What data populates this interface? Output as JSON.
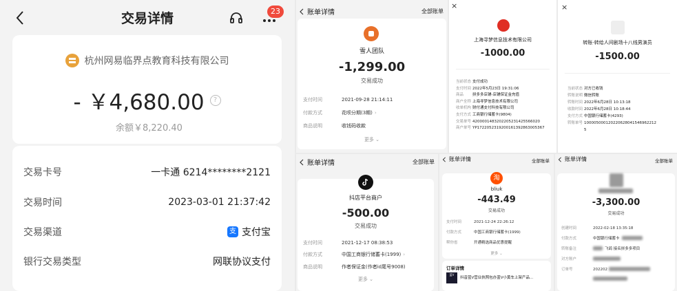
{
  "main": {
    "back_icon": "chevron-left-icon",
    "title": "交易详情",
    "support_icon": "headset-icon",
    "more_icon": "ellipsis-icon",
    "badge": "23",
    "merchant": "杭州网易临界点教育科技有限公司",
    "amount": "- ￥4,680.00",
    "balance": "余额￥8,220.40",
    "rows": [
      {
        "label": "交易卡号",
        "value": "一卡通 6214********2121"
      },
      {
        "label": "交易时间",
        "value": "2023-03-01 21:37:42"
      },
      {
        "label": "交易渠道",
        "value": "支付宝"
      },
      {
        "label": "银行交易类型",
        "value": "网联协议支付"
      }
    ]
  },
  "s1": {
    "header_title": "账单详情",
    "header_right": "全部账单",
    "name": "雪人团队",
    "amount": "-1,299.00",
    "status": "交易成功",
    "rows": [
      {
        "label": "支付时间",
        "value": "2021-09-28 21:14:11"
      },
      {
        "label": "付款方式",
        "value": "花呗分期(3期)"
      },
      {
        "label": "商品说明",
        "value": "收钱码收款"
      }
    ],
    "more": "更多"
  },
  "s2": {
    "close": "×",
    "name": "上海寻梦信息技术有限公司",
    "amount": "-1000.00",
    "rows": [
      {
        "label": "当前状态",
        "value": "支付成功"
      },
      {
        "label": "支付时间",
        "value": "2022年5月23日 19:31:06"
      },
      {
        "label": "商品",
        "value": "拼多多店铺-店铺保证金充值"
      },
      {
        "label": "商户全称",
        "value": "上海寻梦信息技术有限公司"
      },
      {
        "label": "收单机构",
        "value": "财付通支付科技有限公司"
      },
      {
        "label": "支付方式",
        "value": "工商银行储蓄卡(9804)"
      },
      {
        "label": "交易单号",
        "value": "4200001483202205231425566020"
      },
      {
        "label": "商户单号",
        "value": "YP17220523192001613928630053​67"
      }
    ]
  },
  "s3": {
    "close": "×",
    "name": "转账-转给人间剧场十八线男演员",
    "amount": "-1500.00",
    "rows": [
      {
        "label": "当前状态",
        "value": "对方已收钱"
      },
      {
        "label": "转账说明",
        "value": "微信转账"
      },
      {
        "label": "转账时间",
        "value": "2022年6月28日 10:13:18"
      },
      {
        "label": "收款时间",
        "value": "2022年6月28日 10:18:44"
      },
      {
        "label": "支付方式",
        "value": "中国银行储蓄卡(4293)"
      },
      {
        "label": "转账单号",
        "value": "1000050001202206280415469622125"
      }
    ]
  },
  "s4": {
    "header_title": "账单详情",
    "header_right": "全部账单",
    "name": "抖店平台商户",
    "amount": "-500.00",
    "status": "交易成功",
    "rows": [
      {
        "label": "支付时间",
        "value": "2021-12-17 08:38:53"
      },
      {
        "label": "付款方式",
        "value": "中国工商银行储蓄卡(1999)"
      },
      {
        "label": "商品说明",
        "value": "作者保证金(作者id尾号9008)"
      }
    ],
    "more": "更多"
  },
  "s5": {
    "header_title": "账单详情",
    "header_right": "全部账单",
    "name": "bliuk",
    "amount": "-443.49",
    "status": "交易成功",
    "rows": [
      {
        "label": "支付时间",
        "value": "2021-12-24 22:26:12"
      },
      {
        "label": "付款方式",
        "value": "中国工商银行储蓄卡(1999)"
      },
      {
        "label": "帮你省",
        "value": "开通精选商品优惠提醒"
      }
    ],
    "more": "更多",
    "order_title": "订单详情",
    "order_text": "抖音蓝V营业执照包办蓝V小黄车上架产品..."
  },
  "s6": {
    "header_title": "账单详情",
    "header_right": "全部账单",
    "amount": "-3,300.00",
    "status": "交易成功",
    "rows": [
      {
        "label": "创建时间",
        "value": "2022-02-18 13:35:18"
      },
      {
        "label": "付款方式",
        "value": "中国银行储蓄卡"
      },
      {
        "label": "转账备注",
        "value": "飞鸽 接名拼多多项目"
      },
      {
        "label": "对方账户",
        "value": ""
      },
      {
        "label": "订单号",
        "value": "202202"
      }
    ]
  },
  "colors": {
    "orange": "#e8a23b",
    "alipay": "#1677ff",
    "red_badge": "#f04a3c"
  }
}
